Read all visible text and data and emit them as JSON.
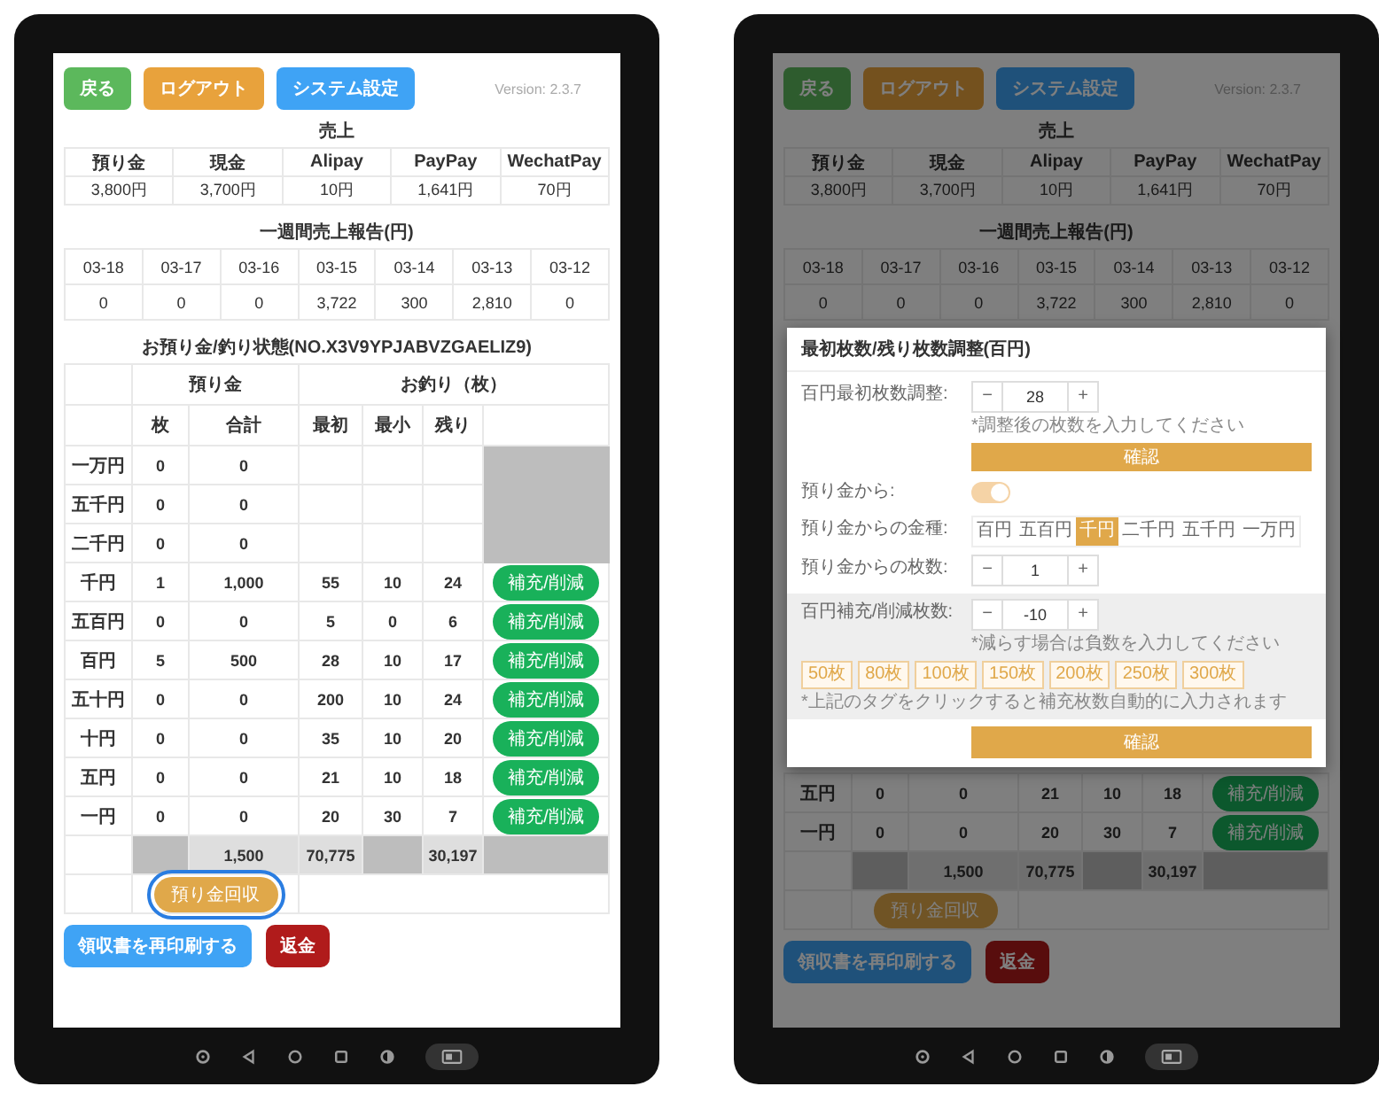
{
  "tablets": [
    {
      "header": {
        "buttons": [
          {
            "label": "戻る",
            "kind": "success"
          },
          {
            "label": "ログアウト",
            "kind": "warning"
          },
          {
            "label": "システム設定",
            "kind": "info"
          }
        ],
        "version": "Version: 2.3.7"
      },
      "sales": {
        "title": "売上",
        "columns": [
          "預り金",
          "現金",
          "Alipay",
          "PayPay",
          "WechatPay"
        ],
        "values": [
          "3,800円",
          "3,700円",
          "10円",
          "1,641円",
          "70円"
        ]
      },
      "weekly": {
        "title": "一週間売上報告(円)",
        "dates": [
          "03-18",
          "03-17",
          "03-16",
          "03-15",
          "03-14",
          "03-13",
          "03-12"
        ],
        "values": [
          "0",
          "0",
          "0",
          "3,722",
          "300",
          "2,810",
          "0"
        ]
      },
      "change": {
        "title": "お預り金/釣り状態(NO.X3V9YPJABVZGAELIZ9)",
        "groups": [
          "預り金",
          "お釣り（枚）"
        ],
        "columns": [
          "枚",
          "合計",
          "最初",
          "最小",
          "残り"
        ],
        "rows": [
          {
            "denomination": "一万円",
            "count": "0",
            "total": "0"
          },
          {
            "denomination": "五千円",
            "count": "0",
            "total": "0"
          },
          {
            "denomination": "二千円",
            "count": "0",
            "total": "0"
          },
          {
            "denomination": "千円",
            "count": "1",
            "total": "1,000",
            "initial": "55",
            "minimum": "10",
            "remaining": "24",
            "action": "補充/削減"
          },
          {
            "denomination": "五百円",
            "count": "0",
            "total": "0",
            "initial": "5",
            "minimum": "0",
            "remaining": "6",
            "action": "補充/削減"
          },
          {
            "denomination": "百円",
            "count": "5",
            "total": "500",
            "initial": "28",
            "minimum": "10",
            "remaining": "17",
            "action": "補充/削減"
          },
          {
            "denomination": "五十円",
            "count": "0",
            "total": "0",
            "initial": "200",
            "minimum": "10",
            "remaining": "24",
            "action": "補充/削減"
          },
          {
            "denomination": "十円",
            "count": "0",
            "total": "0",
            "initial": "35",
            "minimum": "10",
            "remaining": "20",
            "action": "補充/削減"
          },
          {
            "denomination": "五円",
            "count": "0",
            "total": "0",
            "initial": "21",
            "minimum": "10",
            "remaining": "18",
            "action": "補充/削減"
          },
          {
            "denomination": "一円",
            "count": "0",
            "total": "0",
            "initial": "20",
            "minimum": "30",
            "remaining": "7",
            "action": "補充/削減"
          }
        ],
        "totals": [
          {
            "kind": "blank"
          },
          {
            "kind": "dark"
          },
          {
            "kind": "light",
            "value": "1,500"
          },
          {
            "kind": "light",
            "value": "70,775"
          },
          {
            "kind": "dark"
          },
          {
            "kind": "light",
            "value": "30,197"
          },
          {
            "kind": "dark"
          }
        ],
        "collect_button": {
          "label": "預り金回収",
          "focused": true
        }
      },
      "footer_buttons": [
        {
          "label": "領収書を再印刷する",
          "kind": "primary"
        },
        {
          "label": "返金",
          "kind": "danger"
        }
      ]
    },
    {
      "header": {
        "buttons": [
          {
            "label": "戻る",
            "kind": "success"
          },
          {
            "label": "ログアウト",
            "kind": "warning"
          },
          {
            "label": "システム設定",
            "kind": "info"
          }
        ],
        "version": "Version: 2.3.7"
      },
      "sales": {
        "title": "売上",
        "columns": [
          "預り金",
          "現金",
          "Alipay",
          "PayPay",
          "WechatPay"
        ],
        "values": [
          "3,800円",
          "3,700円",
          "10円",
          "1,641円",
          "70円"
        ]
      },
      "weekly": {
        "title": "一週間売上報告(円)",
        "dates": [
          "03-18",
          "03-17",
          "03-16",
          "03-15",
          "03-14",
          "03-13",
          "03-12"
        ],
        "values": [
          "0",
          "0",
          "0",
          "3,722",
          "300",
          "2,810",
          "0"
        ]
      },
      "modal": {
        "title": "最初枚数/残り枚数調整(百円)",
        "fields": [
          {
            "kind": "stepper",
            "label": "百円最初枚数調整:",
            "decrement": "−",
            "value": "28",
            "increment": "+",
            "hint": "*調整後の枚数を入力してください",
            "button": "確認"
          },
          {
            "kind": "toggle",
            "label": "預り金から:",
            "on": true
          },
          {
            "kind": "segments",
            "label": "預り金からの金種:",
            "options": [
              {
                "label": "百円",
                "selected": false
              },
              {
                "label": "五百円",
                "selected": false
              },
              {
                "label": "千円",
                "selected": true
              },
              {
                "label": "二千円",
                "selected": false
              },
              {
                "label": "五千円",
                "selected": false
              },
              {
                "label": "一万円",
                "selected": false
              }
            ]
          },
          {
            "kind": "stepper",
            "label": "預り金からの枚数:",
            "decrement": "−",
            "value": "1",
            "increment": "+"
          },
          {
            "kind": "stepper",
            "label": "百円補充/削減枚数:",
            "decrement": "−",
            "value": "-10",
            "increment": "+",
            "shaded": true,
            "hint": "*減らす場合は負数を入力してください",
            "chips": [
              "50枚",
              "80枚",
              "100枚",
              "150枚",
              "200枚",
              "250枚",
              "300枚"
            ],
            "note": "*上記のタグをクリックすると補充枚数自動的に入力されます"
          }
        ],
        "confirm": "確認"
      },
      "change": {
        "rows": [
          {
            "denomination": "五円",
            "count": "0",
            "total": "0",
            "initial": "21",
            "minimum": "10",
            "remaining": "18",
            "action": "補充/削減"
          },
          {
            "denomination": "一円",
            "count": "0",
            "total": "0",
            "initial": "20",
            "minimum": "30",
            "remaining": "7",
            "action": "補充/削減"
          }
        ],
        "totals": [
          {
            "kind": "blank"
          },
          {
            "kind": "dark"
          },
          {
            "kind": "light",
            "value": "1,500"
          },
          {
            "kind": "light",
            "value": "70,775"
          },
          {
            "kind": "dark"
          },
          {
            "kind": "light",
            "value": "30,197"
          },
          {
            "kind": "dark"
          }
        ],
        "collect_button": {
          "label": "預り金回収",
          "focused": false
        }
      },
      "footer_buttons": [
        {
          "label": "領収書を再印刷する",
          "kind": "primary"
        },
        {
          "label": "返金",
          "kind": "danger"
        }
      ]
    }
  ]
}
